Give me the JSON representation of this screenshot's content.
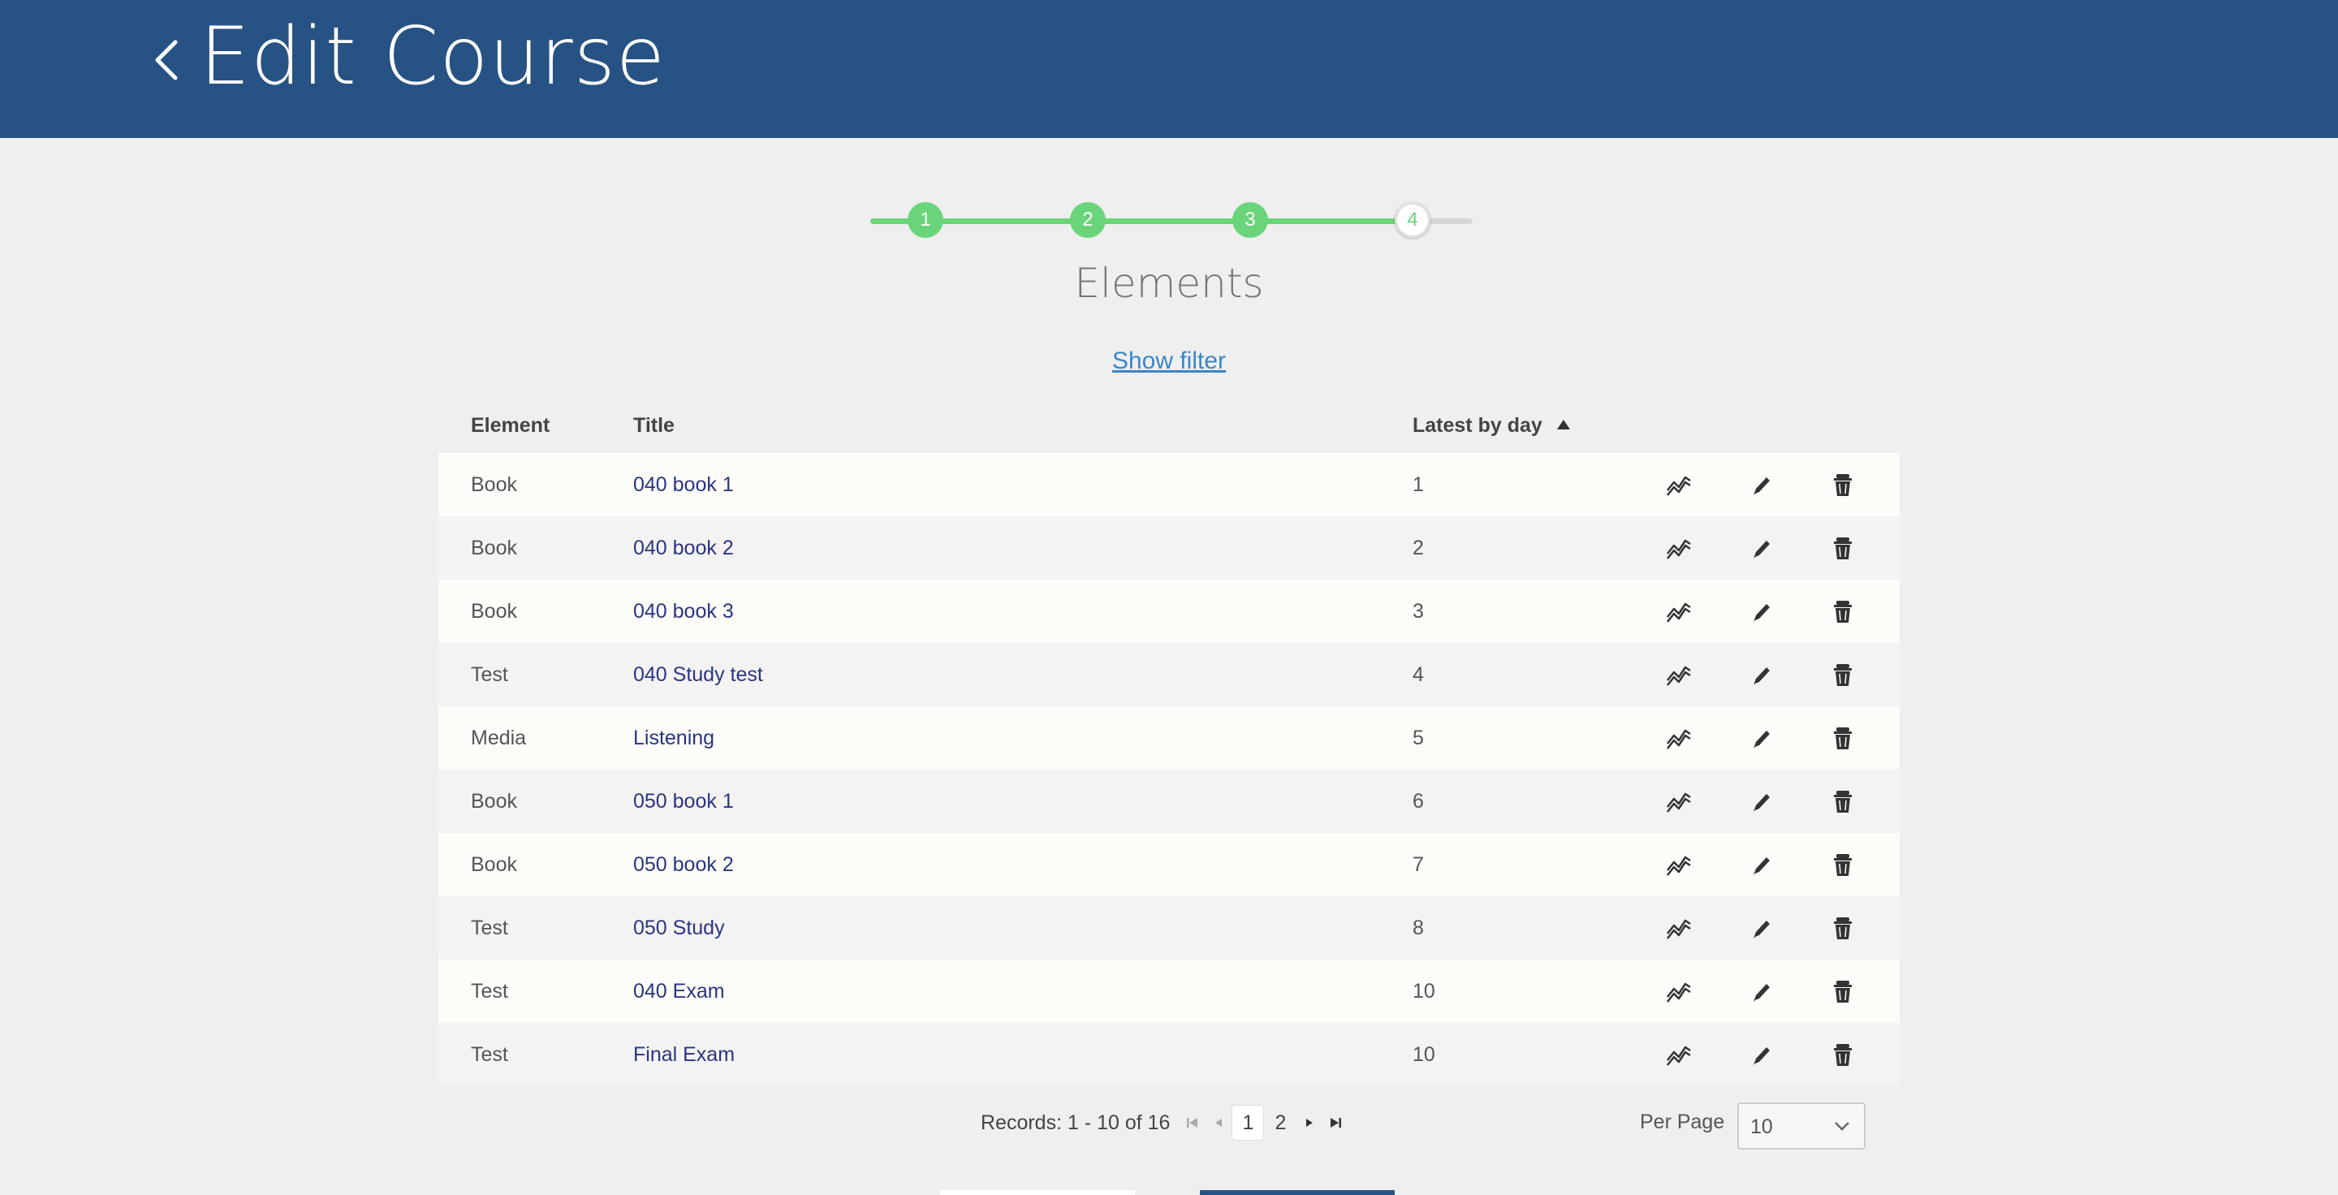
{
  "header": {
    "title": "Edit Course"
  },
  "stepper": {
    "steps": [
      "1",
      "2",
      "3",
      "4"
    ],
    "current": 4
  },
  "section": {
    "title": "Elements",
    "filter_link": "Show filter"
  },
  "table": {
    "headers": {
      "element": "Element",
      "title": "Title",
      "latest": "Latest by day"
    },
    "rows": [
      {
        "element": "Book",
        "title": "040 book 1",
        "day": "1"
      },
      {
        "element": "Book",
        "title": "040 book 2",
        "day": "2"
      },
      {
        "element": "Book",
        "title": "040 book 3",
        "day": "3"
      },
      {
        "element": "Test",
        "title": "040 Study test",
        "day": "4"
      },
      {
        "element": "Media",
        "title": "Listening",
        "day": "5"
      },
      {
        "element": "Book",
        "title": "050 book 1",
        "day": "6"
      },
      {
        "element": "Book",
        "title": "050 book 2",
        "day": "7"
      },
      {
        "element": "Test",
        "title": "050 Study",
        "day": "8"
      },
      {
        "element": "Test",
        "title": "040 Exam",
        "day": "10"
      },
      {
        "element": "Test",
        "title": "Final Exam",
        "day": "10"
      }
    ]
  },
  "pagination": {
    "records": "Records: 1 - 10 of 16",
    "pages": [
      "1",
      "2"
    ],
    "current_page": "1",
    "per_page_label": "Per Page",
    "per_page_value": "10"
  },
  "colors": {
    "header": "#275384",
    "step_done": "#6ad47a",
    "link": "#2a3580"
  },
  "icons": [
    "chevron-left-icon",
    "stats-icon",
    "pencil-icon",
    "trash-icon",
    "first-page-icon",
    "prev-page-icon",
    "next-page-icon",
    "last-page-icon",
    "chevron-down-icon"
  ]
}
